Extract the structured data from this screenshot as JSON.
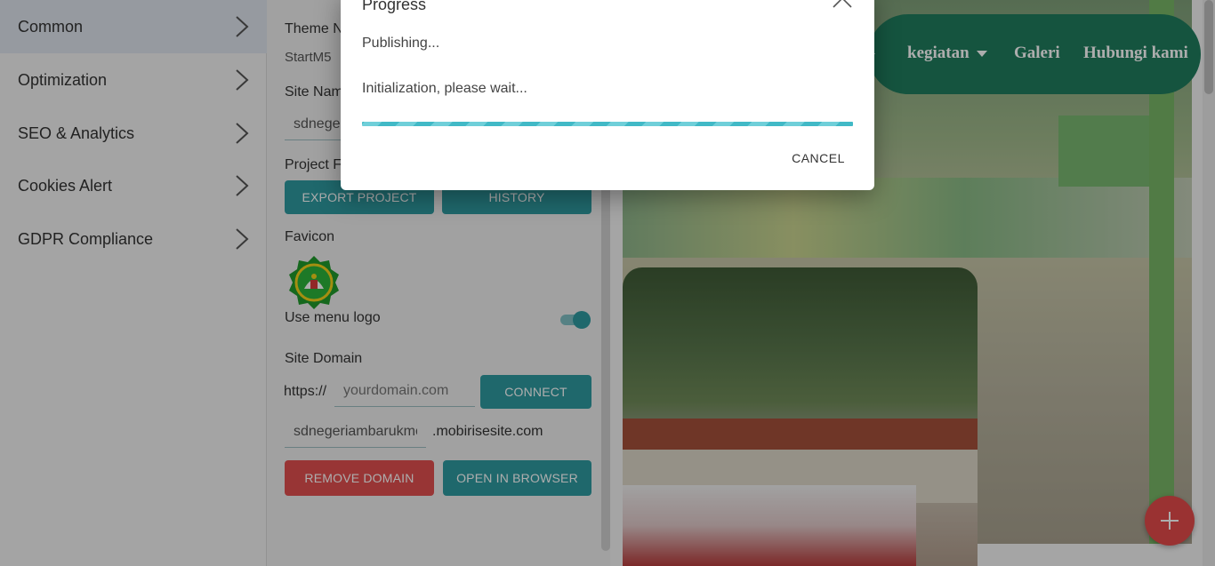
{
  "sidebar": {
    "items": [
      {
        "label": "Common",
        "active": true
      },
      {
        "label": "Optimization"
      },
      {
        "label": "SEO & Analytics"
      },
      {
        "label": "Cookies Alert"
      },
      {
        "label": "GDPR Compliance"
      }
    ],
    "chevron_icon": "chevron-right-icon"
  },
  "settings": {
    "theme_name_label": "Theme Na",
    "theme_name_value": "StartM5",
    "site_name_label": "Site Name",
    "site_name_value": "sdnegeri",
    "project_files_label": "Project Fi",
    "export_button": "EXPORT PROJECT",
    "history_button": "HISTORY",
    "favicon_label": "Favicon",
    "use_menu_logo_label": "Use menu logo",
    "use_menu_logo_on": true,
    "site_domain_label": "Site Domain",
    "protocol_prefix": "https://",
    "domain_placeholder": "yourdomain.com",
    "connect_button": "CONNECT",
    "subdomain_value": "sdnegeriambarukmo",
    "subdomain_suffix": ".mobirisesite.com",
    "remove_domain_button": "REMOVE DOMAIN",
    "open_in_browser_button": "OPEN IN BROWSER"
  },
  "preview": {
    "nav_items": [
      "kegiatan",
      "Galeri",
      "Hubungi kami"
    ],
    "fab_icon": "plus-icon",
    "colors": {
      "nav": "#1f7d5e",
      "fab": "#e34b4b"
    }
  },
  "dialog": {
    "title": "Progress",
    "status": "Publishing...",
    "detail": "Initialization, please wait...",
    "cancel_label": "CANCEL",
    "close_icon": "close-icon",
    "progress_color": "#41b9c6"
  }
}
